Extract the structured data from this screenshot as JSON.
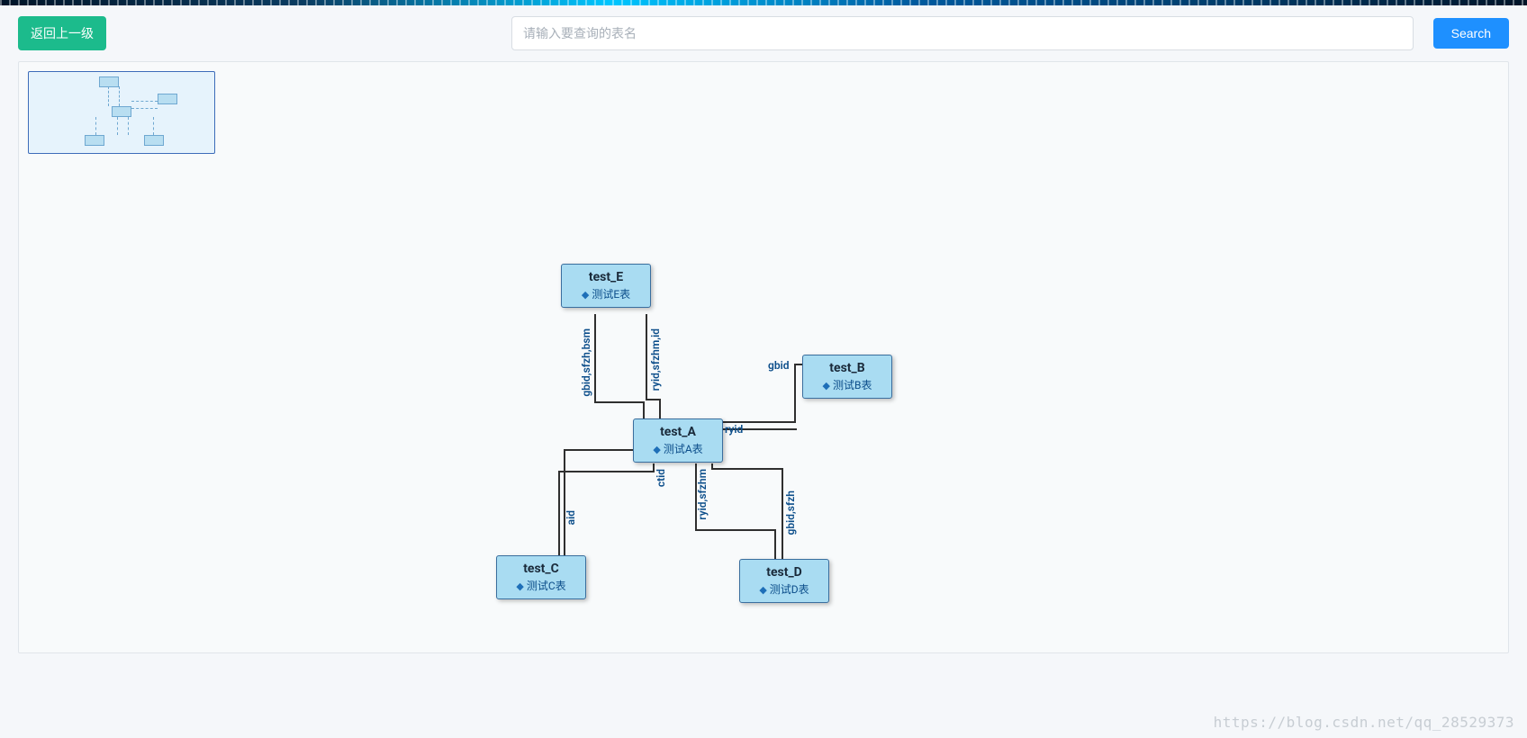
{
  "toolbar": {
    "back_label": "返回上一级",
    "search_placeholder": "请输入要查询的表名",
    "search_button": "Search"
  },
  "nodes": {
    "E": {
      "title": "test_E",
      "subtitle": "测试E表"
    },
    "A": {
      "title": "test_A",
      "subtitle": "测试A表"
    },
    "B": {
      "title": "test_B",
      "subtitle": "测试B表"
    },
    "C": {
      "title": "test_C",
      "subtitle": "测试C表"
    },
    "D": {
      "title": "test_D",
      "subtitle": "测试D表"
    }
  },
  "edges": {
    "EA_left": "gbid,sfzh,bsm",
    "EA_right": "ryid,sfzhm,id",
    "AB_top": "gbid",
    "AB_bottom": "ryid",
    "AC_a": "ctid",
    "AC_b": "aid",
    "AD_a": "ryid,sfzhm",
    "AD_b": "gbid,sfzh"
  },
  "watermark": "https://blog.csdn.net/qq_28529373"
}
